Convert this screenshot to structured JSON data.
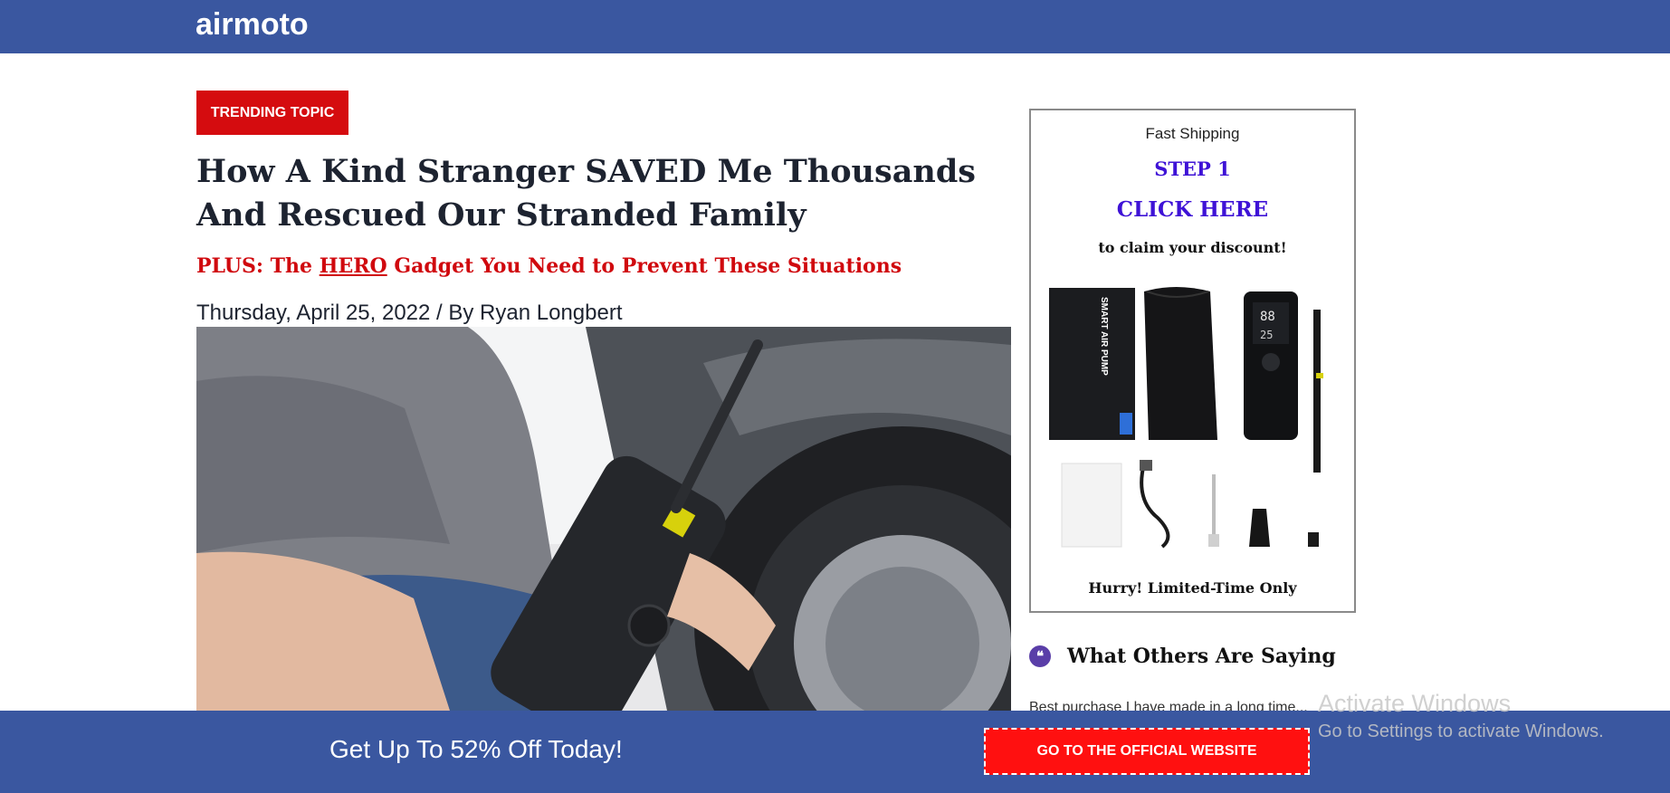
{
  "header": {
    "logo": "airmoto"
  },
  "article": {
    "badge": "TRENDING TOPIC",
    "headline": "How A Kind Stranger SAVED Me Thousands And Rescued Our Stranded Family",
    "subhead_before": "PLUS: The ",
    "subhead_hero": "HERO",
    "subhead_after": " Gadget You Need to Prevent These Situations",
    "byline": "Thursday, April 25, 2022 / By Ryan Longbert"
  },
  "sidebar": {
    "shipping": "Fast Shipping",
    "step": "STEP 1",
    "click": "CLICK HERE",
    "claim": "to claim your discount!",
    "hurry": "Hurry! Limited-Time Only",
    "product_box_text": "SMART AIR PUMP"
  },
  "testimonials": {
    "title": "What Others Are Saying",
    "first_review": "Best purchase I have made in a long time..."
  },
  "footer_bar": {
    "text": "Get Up To 52% Off Today!",
    "cta": "GO TO THE OFFICIAL WEBSITE"
  },
  "watermark": {
    "line1": "Activate Windows",
    "line2": "Go to Settings to activate Windows."
  },
  "colors": {
    "brand_blue": "#3a57a0",
    "badge_red": "#d50c0f",
    "cta_red": "#ff1010",
    "accent_purple": "#3e12d6"
  },
  "icons": {
    "quote": "quote-icon"
  }
}
